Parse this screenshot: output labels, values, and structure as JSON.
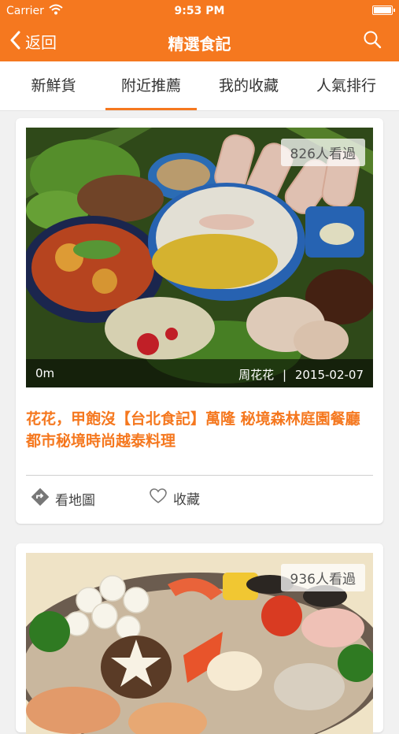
{
  "status_bar": {
    "carrier": "Carrier",
    "time": "9:53 PM"
  },
  "nav": {
    "back_label": "返回",
    "title": "精選食記"
  },
  "tabs": [
    {
      "label": "新鮮貨"
    },
    {
      "label": "附近推薦"
    },
    {
      "label": "我的收藏"
    },
    {
      "label": "人氣排行"
    }
  ],
  "active_tab": 1,
  "posts": [
    {
      "views": "826人看過",
      "distance": "0m",
      "author": "周花花",
      "separator": "|",
      "date": "2015-02-07",
      "title": "花花，甲飽沒【台北食記】萬隆 秘境森林庭園餐廳 都市秘境時尚越泰料理",
      "map_label": "看地圖",
      "fav_label": "收藏"
    },
    {
      "views": "936人看過"
    }
  ],
  "colors": {
    "accent": "#f5781f"
  }
}
